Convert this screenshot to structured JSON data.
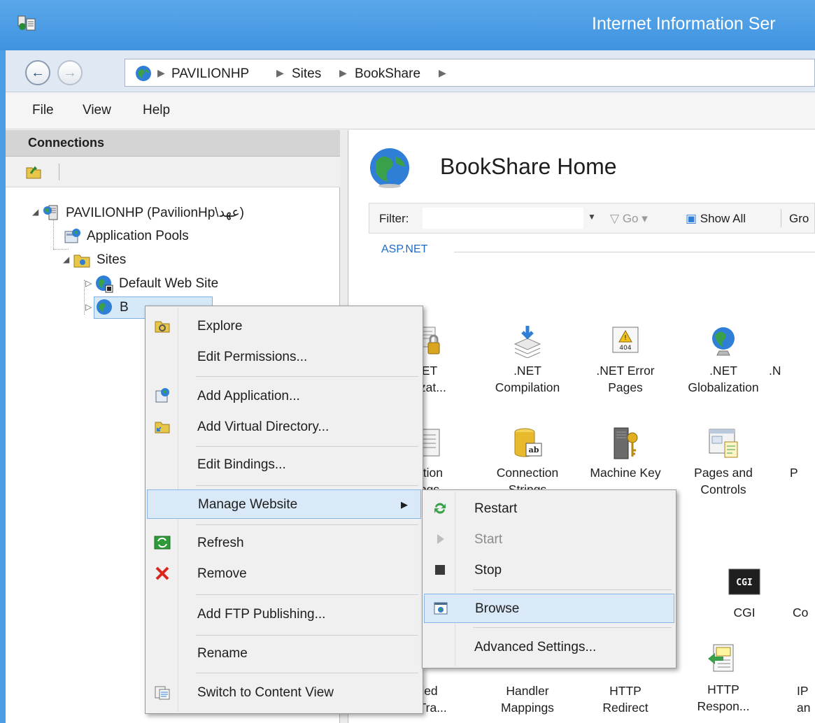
{
  "window": {
    "title": "Internet Information Ser"
  },
  "address": {
    "crumbs": [
      "PAVILIONHP",
      "Sites",
      "BookShare"
    ]
  },
  "menu": {
    "items": [
      "File",
      "View",
      "Help"
    ]
  },
  "connections": {
    "title": "Connections",
    "tree": {
      "server": "PAVILIONHP (PavilionHp\\عهد)",
      "app_pools": "Application Pools",
      "sites": "Sites",
      "default_site": "Default Web Site",
      "bookshare_partial": "B"
    }
  },
  "main": {
    "title": "BookShare Home",
    "filter": {
      "label": "Filter:",
      "go": "Go",
      "show_all": "Show All",
      "group": "Gro"
    },
    "section": "ASP.NET",
    "features_row1": [
      {
        "line1": "ET",
        "line2": "rizat..."
      },
      {
        "line1": ".NET",
        "line2": "Compilation"
      },
      {
        "line1": ".NET Error",
        "line2": "Pages"
      },
      {
        "line1": ".NET",
        "line2": "Globalization"
      },
      {
        "line1": ".N",
        "line2": ""
      }
    ],
    "features_row2": [
      {
        "line1": "ation",
        "line2": "ngs"
      },
      {
        "line1": "Connection",
        "line2": "Strings"
      },
      {
        "line1": "Machine Key",
        "line2": ""
      },
      {
        "line1": "Pages and",
        "line2": "Controls"
      },
      {
        "line1": "P",
        "line2": ""
      }
    ],
    "features_row3": [
      {
        "line1": "CGI",
        "line2": ""
      },
      {
        "line1": "Co",
        "line2": ""
      }
    ],
    "features_row4": [
      {
        "line1": "led",
        "line2": "t Tra..."
      },
      {
        "line1": "Handler",
        "line2": "Mappings"
      },
      {
        "line1": "HTTP",
        "line2": "Redirect"
      },
      {
        "line1": "HTTP",
        "line2": "Respon..."
      },
      {
        "line1": "IP",
        "line2": "an"
      }
    ],
    "cgi_icon_text": "CGI"
  },
  "context_menu": {
    "items": [
      "Explore",
      "Edit Permissions...",
      "Add Application...",
      "Add Virtual Directory...",
      "Edit Bindings...",
      "Manage Website",
      "Refresh",
      "Remove",
      "Add FTP Publishing...",
      "Rename",
      "Switch to Content View"
    ]
  },
  "submenu": {
    "items": [
      "Restart",
      "Start",
      "Stop",
      "Browse",
      "Advanced Settings..."
    ]
  },
  "colors": {
    "title_bar": "#3f93e0",
    "section_label": "#1d6ac9",
    "menu_hover": "#d9e9f8",
    "remove_x": "#d9261c"
  }
}
